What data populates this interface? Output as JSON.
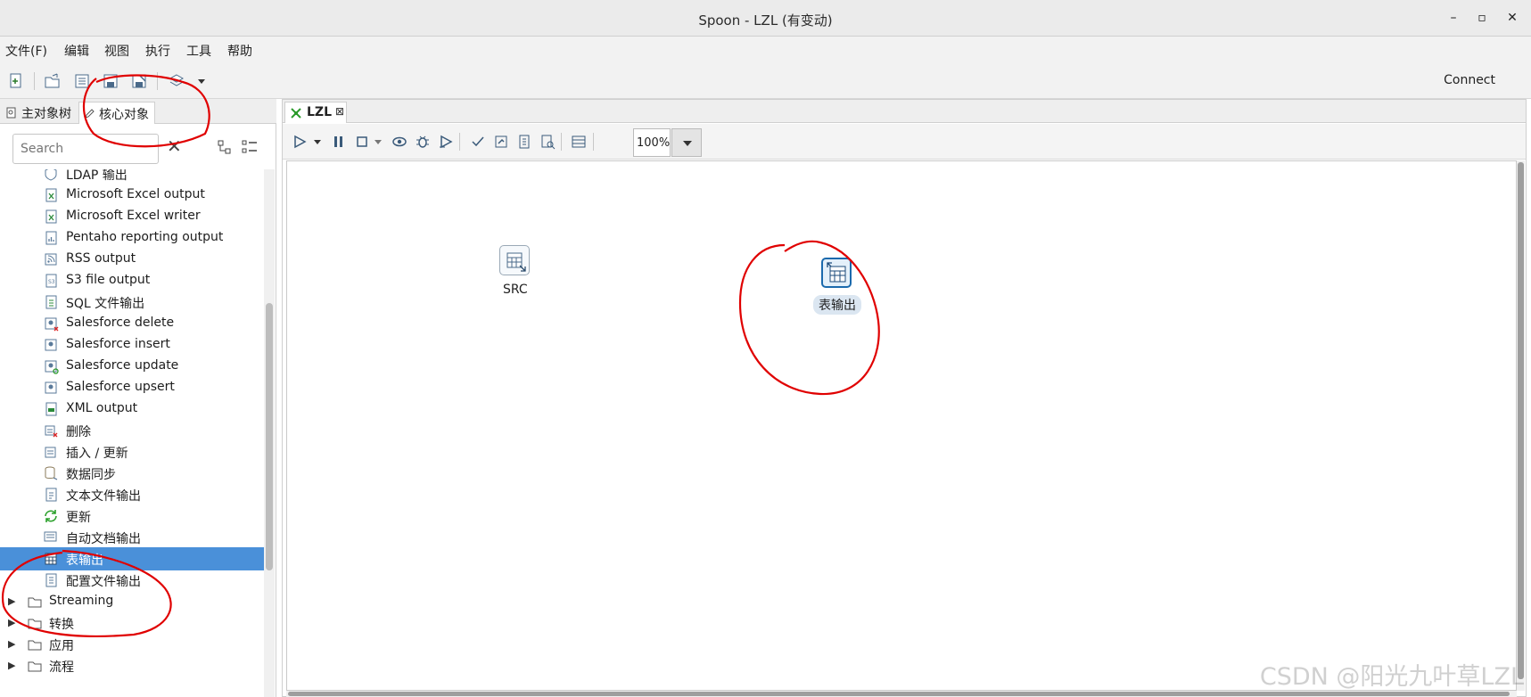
{
  "window": {
    "title": "Spoon - LZL (有变动)",
    "controls": [
      "–",
      "▫",
      "✕"
    ]
  },
  "menu": [
    "文件(F)",
    "编辑",
    "视图",
    "执行",
    "工具",
    "帮助"
  ],
  "toolbar": {
    "connect_label": "Connect"
  },
  "left_panel": {
    "tabs": [
      {
        "label": "主对象树"
      },
      {
        "label": "核心对象"
      }
    ],
    "search": {
      "placeholder": "Search",
      "value": ""
    },
    "items": [
      {
        "label": "LDAP 输出",
        "icon": "ldap-icon"
      },
      {
        "label": "Microsoft Excel output",
        "icon": "excel-icon"
      },
      {
        "label": "Microsoft Excel writer",
        "icon": "excel-icon"
      },
      {
        "label": "Pentaho reporting output",
        "icon": "report-icon"
      },
      {
        "label": "RSS output",
        "icon": "rss-icon"
      },
      {
        "label": "S3 file output",
        "icon": "s3-icon"
      },
      {
        "label": "SQL 文件输出",
        "icon": "sql-file-icon"
      },
      {
        "label": "Salesforce delete",
        "icon": "salesforce-icon"
      },
      {
        "label": "Salesforce insert",
        "icon": "salesforce-icon"
      },
      {
        "label": "Salesforce update",
        "icon": "salesforce-icon"
      },
      {
        "label": "Salesforce upsert",
        "icon": "salesforce-icon"
      },
      {
        "label": "XML output",
        "icon": "xml-icon"
      },
      {
        "label": "删除",
        "icon": "delete-icon"
      },
      {
        "label": "插入 / 更新",
        "icon": "insert-update-icon"
      },
      {
        "label": "数据同步",
        "icon": "sync-icon"
      },
      {
        "label": "文本文件输出",
        "icon": "text-file-icon"
      },
      {
        "label": "更新",
        "icon": "refresh-icon"
      },
      {
        "label": "自动文档输出",
        "icon": "doc-icon"
      },
      {
        "label": "表输出",
        "icon": "table-icon",
        "selected": true
      },
      {
        "label": "配置文件输出",
        "icon": "config-file-icon"
      }
    ],
    "folders": [
      {
        "label": "Streaming"
      },
      {
        "label": "转换"
      },
      {
        "label": "应用"
      },
      {
        "label": "流程"
      }
    ]
  },
  "workspace": {
    "tab_label": "LZL",
    "zoom": "100%",
    "steps": [
      {
        "name": "SRC",
        "icon": "table-input-icon"
      },
      {
        "name": "表输出",
        "icon": "table-output-icon",
        "selected": true
      }
    ]
  },
  "watermark": "CSDN @阳光九叶草LZL",
  "colors": {
    "selection": "#4a90d9",
    "annotation": "#e00000"
  }
}
